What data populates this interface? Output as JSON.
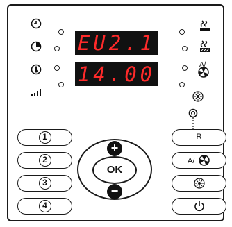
{
  "display": {
    "top_text": "EU2.1",
    "bottom_text": "14.00"
  },
  "icons_left": [
    "clock-icon",
    "timer-icon",
    "thermometer-icon",
    "signal-bars-icon"
  ],
  "icons_right": [
    "heating-icon",
    "heating-hatched-icon",
    "auto-fan-icon",
    "fan-icon"
  ],
  "buttons_left": [
    "1",
    "2",
    "3",
    "4"
  ],
  "buttons_right": {
    "reset_label": "R",
    "auto_fan": "auto-fan-icon",
    "fan": "fan-icon",
    "power": "power-icon"
  },
  "center": {
    "plus": "+",
    "ok": "OK",
    "minus": "−"
  },
  "colors": {
    "display_bg": "#111111",
    "display_text": "#ff2a2a"
  }
}
